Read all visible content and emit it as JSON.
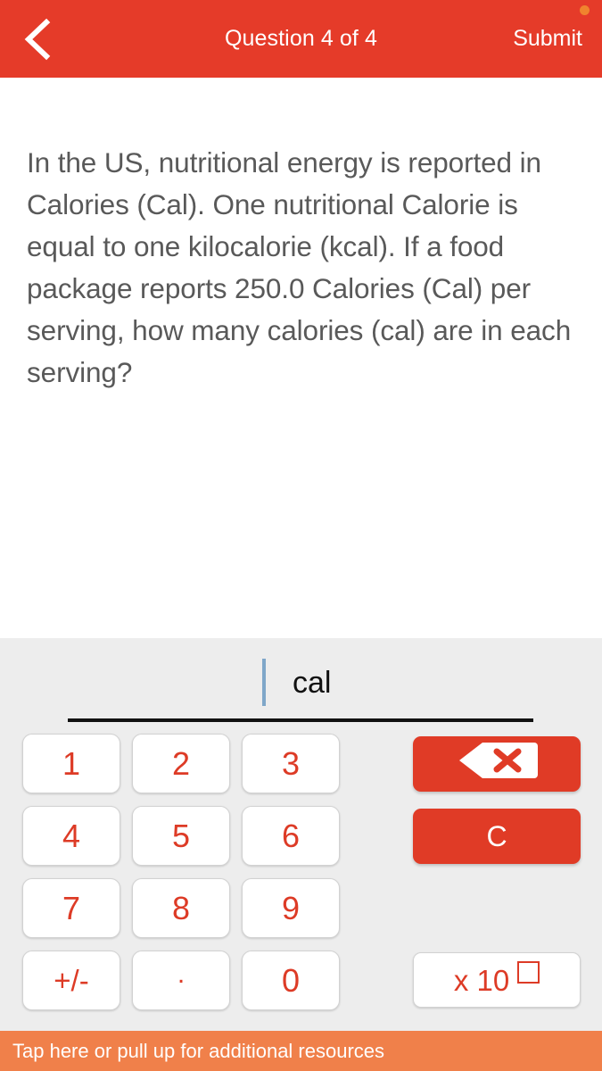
{
  "header": {
    "back_icon": "chevron-left-icon",
    "title": "Question 4 of 4",
    "submit_label": "Submit",
    "status_dot": "notification-dot",
    "background_color": "#E53B29",
    "text_color": "#FFFFFF"
  },
  "question": {
    "text": "In the US, nutritional energy is reported in Calories (Cal). One nutritional Calorie is equal to one kilocalorie (kcal). If a food package reports 250.0 Calories (Cal) per serving, how many calories (cal) are in each serving?",
    "text_color": "#595959"
  },
  "answer": {
    "value": "",
    "unit": "cal",
    "caret_color": "#7FA7C9",
    "underline_color": "#111111"
  },
  "keypad": {
    "background_color": "#EDEDED",
    "key_text_color": "#DD3B26",
    "keys": [
      {
        "label": "1",
        "name": "key-1"
      },
      {
        "label": "2",
        "name": "key-2"
      },
      {
        "label": "3",
        "name": "key-3"
      },
      {
        "label": "4",
        "name": "key-4"
      },
      {
        "label": "5",
        "name": "key-5"
      },
      {
        "label": "6",
        "name": "key-6"
      },
      {
        "label": "7",
        "name": "key-7"
      },
      {
        "label": "8",
        "name": "key-8"
      },
      {
        "label": "9",
        "name": "key-9"
      },
      {
        "label": "+/-",
        "name": "key-sign"
      },
      {
        "label": ".",
        "name": "key-decimal"
      },
      {
        "label": "0",
        "name": "key-0"
      }
    ],
    "actions": {
      "backspace_icon": "backspace-delete-icon",
      "clear_label": "C",
      "exponent_prefix": "x 10",
      "exponent_placeholder": "empty-box",
      "action_color": "#E03B26"
    }
  },
  "resource_bar": {
    "label": "Tap here or pull up for additional resources",
    "background_color": "#F0804A",
    "text_color": "#FFFFFF"
  }
}
